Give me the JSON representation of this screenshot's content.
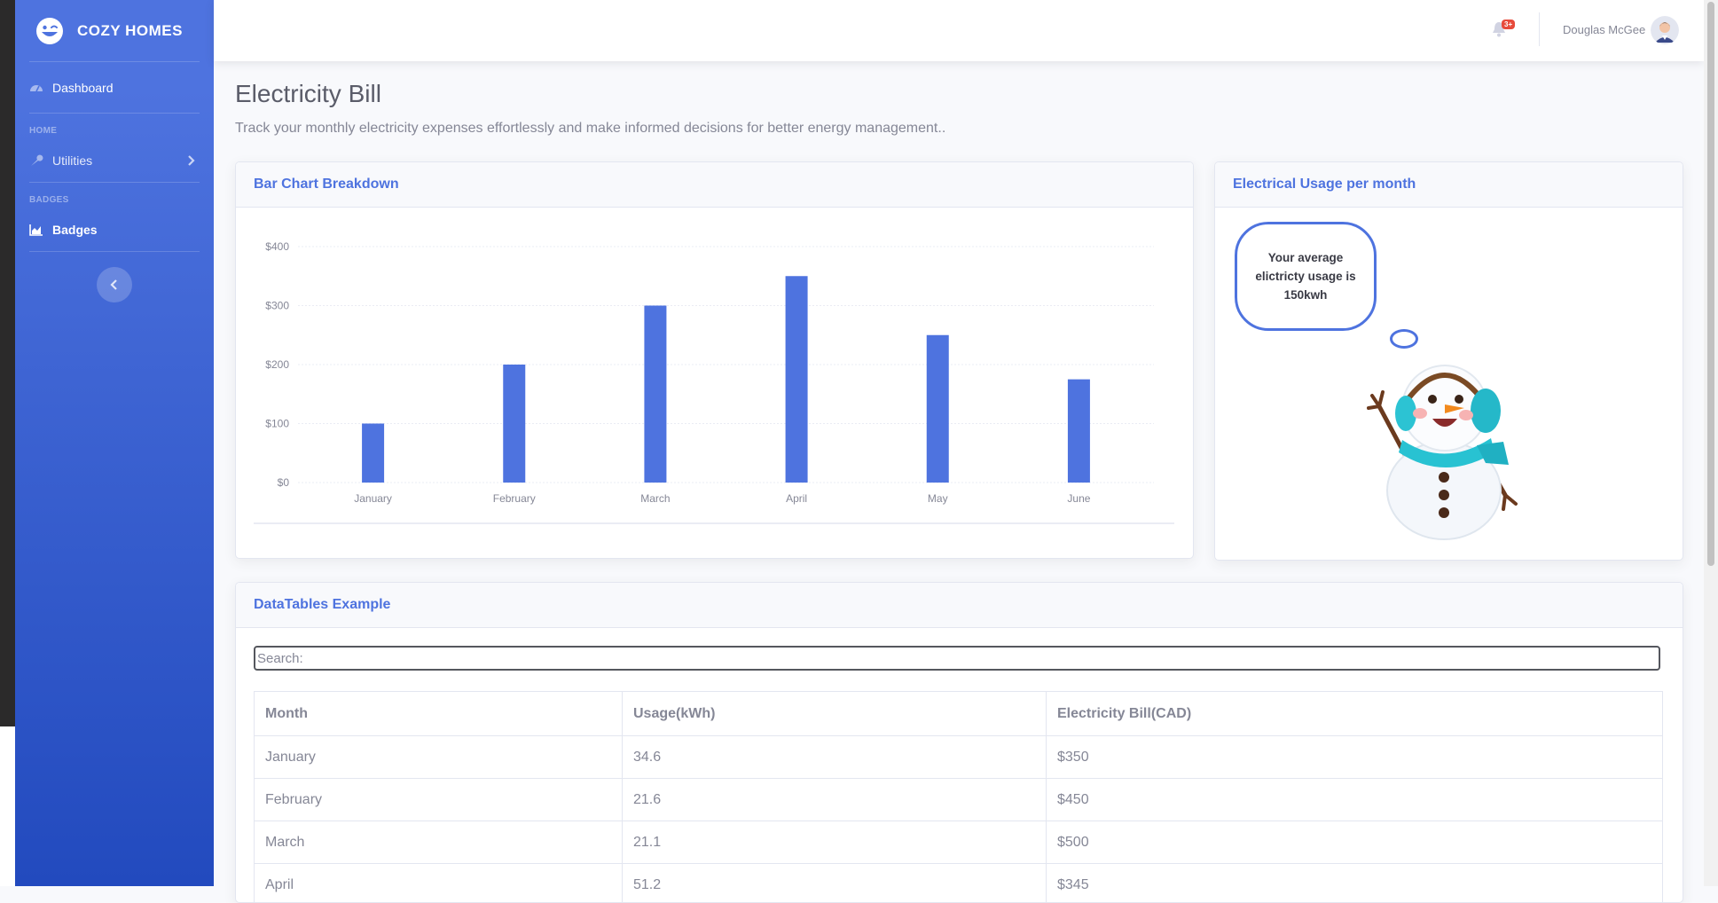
{
  "brand": {
    "name": "COZY HOMES"
  },
  "sidebar": {
    "dashboard_label": "Dashboard",
    "headings": [
      "HOME",
      "BADGES"
    ],
    "utilities_label": "Utilities",
    "badges_label": "Badges"
  },
  "topbar": {
    "alert_count": "3+",
    "user_name": "Douglas McGee"
  },
  "page": {
    "title": "Electricity Bill",
    "subtitle": "Track your monthly electricity expenses effortlessly and make informed decisions for better energy management.."
  },
  "bar_card": {
    "title": "Bar Chart Breakdown"
  },
  "usage_card": {
    "title": "Electrical Usage per month",
    "bubble_text": "Your average elictricty usage is 150kwh"
  },
  "table_card": {
    "title": "DataTables Example",
    "search_placeholder": "Search:",
    "columns": [
      "Month",
      "Usage(kWh)",
      "Electricity Bill(CAD)"
    ],
    "rows": [
      [
        "January",
        "34.6",
        "$350"
      ],
      [
        "February",
        "21.6",
        "$450"
      ],
      [
        "March",
        "21.1",
        "$500"
      ],
      [
        "April",
        "51.2",
        "$345"
      ]
    ]
  },
  "colors": {
    "primary": "#4e73df",
    "danger": "#e74a3b",
    "text": "#858796"
  },
  "chart_data": {
    "type": "bar",
    "categories": [
      "January",
      "February",
      "March",
      "April",
      "May",
      "June"
    ],
    "values": [
      100,
      200,
      300,
      350,
      250,
      175
    ],
    "y_ticks": [
      "$0",
      "$100",
      "$200",
      "$300",
      "$400"
    ],
    "ylim": [
      0,
      400
    ],
    "grid": true,
    "bar_color": "#4e73df"
  }
}
